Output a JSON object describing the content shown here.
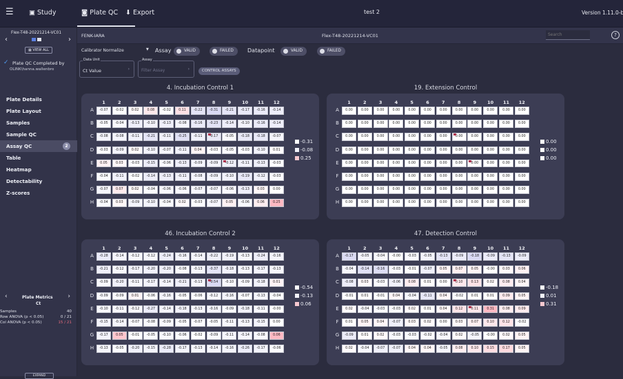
{
  "topbar": {
    "menu_icon": "hamburger-icon",
    "study": "Study",
    "plate_qc": "Plate QC",
    "export": "Export",
    "title": "test 2",
    "version": "Version 1.11.0-beta"
  },
  "sidebar": {
    "plate_name": "Flex-T48-20221214-VC01",
    "view_all": "VIEW ALL",
    "completed": "Plate QC Completed by",
    "user": "OLINK\\hanna.wallenbro",
    "nav": [
      "Plate Details",
      "Plate Layout",
      "Samples",
      "Sample QC",
      "Assay QC",
      "Table",
      "Heatmap",
      "Detectability",
      "Z-scores"
    ],
    "assay_qc_badge": "2",
    "metrics": {
      "title": "Plate Metrics",
      "sub": "Ct",
      "rows": [
        {
          "k": "Samples",
          "v": "40"
        },
        {
          "k": "Row ANOVA (p < 0.05)",
          "v": "0 / 21"
        },
        {
          "k": "Col ANOVA (p < 0.05)",
          "v": "15 / 21"
        }
      ]
    },
    "expand": "EXPAND"
  },
  "header": {
    "left": "FENK-IARA",
    "center": "Flex-T48-20221214-VC01",
    "search_placeholder": "Search",
    "help": "?"
  },
  "filters": {
    "normalize": "Calibrator Normalize",
    "assay": "Assay",
    "valid": "VALID",
    "failed": "FAILED",
    "datapoint": "Datapoint",
    "data_unit_label": "Data Unit",
    "data_unit": "Ct Value",
    "assay_label": "Assay",
    "assay_placeholder": "Filter Assay",
    "control": "CONTROL ASSAYS"
  },
  "rows": [
    "A",
    "B",
    "C",
    "D",
    "E",
    "F",
    "G",
    "H"
  ],
  "cols": [
    "1",
    "2",
    "3",
    "4",
    "5",
    "6",
    "7",
    "8",
    "9",
    "10",
    "11",
    "12"
  ],
  "plots": [
    {
      "title": "4. Incubation Control 1",
      "legend": [
        "-0.31",
        "-0.08",
        "0.25"
      ],
      "colors": [
        "#ffffff",
        "#f1f1f8",
        "#f6c8cf"
      ],
      "flags": [
        "C8",
        "E9"
      ],
      "v": [
        [
          "-0.07",
          "-0.02",
          "0.02",
          "0.08",
          "-0.02",
          "0.11",
          "-0.22",
          "-0.31",
          "-0.21",
          "-0.17",
          "-0.16",
          "-0.14"
        ],
        [
          "-0.05",
          "-0.04",
          "-0.13",
          "-0.10",
          "-0.13",
          "-0.08",
          "-0.16",
          "-0.23",
          "-0.14",
          "-0.10",
          "-0.16",
          "-0.14"
        ],
        [
          "-0.08",
          "-0.08",
          "-0.11",
          "-0.21",
          "-0.11",
          "-0.25",
          "-0.11",
          "-0.17",
          "-0.05",
          "-0.18",
          "-0.18",
          "-0.07"
        ],
        [
          "-0.03",
          "-0.09",
          "0.02",
          "-0.10",
          "-0.07",
          "-0.11",
          "0.04",
          "-0.03",
          "-0.05",
          "-0.03",
          "-0.10",
          "0.01"
        ],
        [
          "0.05",
          "0.03",
          "-0.03",
          "-0.15",
          "-0.06",
          "-0.13",
          "-0.09",
          "-0.09",
          "-0.12",
          "-0.11",
          "-0.13",
          "-0.03"
        ],
        [
          "-0.04",
          "-0.11",
          "-0.02",
          "-0.14",
          "-0.13",
          "-0.11",
          "-0.08",
          "-0.09",
          "-0.10",
          "-0.19",
          "-0.12",
          "-0.03"
        ],
        [
          "-0.07",
          "0.07",
          "0.02",
          "-0.04",
          "-0.06",
          "-0.06",
          "-0.07",
          "-0.07",
          "-0.06",
          "-0.13",
          "0.03",
          "0.00"
        ],
        [
          "-0.04",
          "0.03",
          "-0.09",
          "-0.10",
          "-0.04",
          "0.02",
          "-0.03",
          "-0.07",
          "0.05",
          "-0.06",
          "0.06",
          "0.25"
        ]
      ]
    },
    {
      "title": "19. Extension Control",
      "legend": [
        "0.00",
        "0.00",
        "0.00"
      ],
      "colors": [
        "#ffffff",
        "#ffffff",
        "#ffffff"
      ],
      "flags": [
        "C8",
        "E9"
      ],
      "v": [
        [
          "0.00",
          "0.00",
          "0.00",
          "0.00",
          "0.00",
          "0.00",
          "0.00",
          "0.00",
          "0.00",
          "0.00",
          "0.00",
          "0.00"
        ],
        [
          "0.00",
          "0.00",
          "0.00",
          "0.00",
          "0.00",
          "0.00",
          "0.00",
          "0.00",
          "0.00",
          "0.00",
          "0.00",
          "0.00"
        ],
        [
          "0.00",
          "0.00",
          "0.00",
          "0.00",
          "0.00",
          "0.00",
          "0.00",
          "0.00",
          "0.00",
          "0.00",
          "0.00",
          "0.00"
        ],
        [
          "0.00",
          "0.00",
          "0.00",
          "0.00",
          "0.00",
          "0.00",
          "0.00",
          "0.00",
          "0.00",
          "0.00",
          "0.00",
          "0.00"
        ],
        [
          "0.00",
          "0.00",
          "0.00",
          "0.00",
          "0.00",
          "0.00",
          "0.00",
          "0.00",
          "0.00",
          "0.00",
          "0.00",
          "0.00"
        ],
        [
          "0.00",
          "0.00",
          "0.00",
          "0.00",
          "0.00",
          "0.00",
          "0.00",
          "0.00",
          "0.00",
          "0.00",
          "0.00",
          "0.00"
        ],
        [
          "0.00",
          "0.00",
          "0.00",
          "0.00",
          "0.00",
          "0.00",
          "0.00",
          "0.00",
          "0.00",
          "0.00",
          "0.00",
          "0.00"
        ],
        [
          "0.00",
          "0.00",
          "0.00",
          "0.00",
          "0.00",
          "0.00",
          "0.00",
          "0.00",
          "0.00",
          "0.00",
          "0.00",
          "0.00"
        ]
      ]
    },
    {
      "title": "46. Incubation Control 2",
      "legend": [
        "-0.54",
        "-0.13",
        "0.06"
      ],
      "colors": [
        "#ffffff",
        "#f1f1f8",
        "#f6c8cf"
      ],
      "flags": [
        "C8"
      ],
      "v": [
        [
          "-0.28",
          "-0.14",
          "-0.12",
          "-0.12",
          "-0.24",
          "-0.16",
          "-0.14",
          "-0.22",
          "-0.19",
          "-0.13",
          "-0.24",
          "-0.16"
        ],
        [
          "-0.21",
          "-0.12",
          "-0.17",
          "-0.20",
          "-0.20",
          "-0.08",
          "-0.13",
          "-0.37",
          "-0.18",
          "-0.13",
          "-0.17",
          "-0.13"
        ],
        [
          "-0.09",
          "-0.20",
          "-0.11",
          "-0.17",
          "-0.14",
          "-0.21",
          "-0.13",
          "-0.54",
          "-0.10",
          "-0.09",
          "-0.18",
          "0.01"
        ],
        [
          "-0.09",
          "-0.09",
          "0.01",
          "-0.06",
          "-0.16",
          "-0.05",
          "-0.06",
          "-0.12",
          "-0.16",
          "-0.07",
          "-0.13",
          "-0.04"
        ],
        [
          "-0.10",
          "-0.11",
          "-0.12",
          "-0.27",
          "-0.14",
          "-0.18",
          "-0.13",
          "-0.16",
          "-0.09",
          "-0.18",
          "-0.11",
          "-0.00"
        ],
        [
          "-0.15",
          "-0.14",
          "-0.07",
          "-0.08",
          "-0.09",
          "-0.05",
          "-0.07",
          "-0.05",
          "-0.11",
          "-0.13",
          "-0.15",
          "0.00"
        ],
        [
          "-0.17",
          "0.05",
          "-0.01",
          "-0.05",
          "-0.10",
          "-0.06",
          "-0.02",
          "-0.09",
          "-0.11",
          "-0.14",
          "-0.08",
          "0.06"
        ],
        [
          "-0.13",
          "-0.05",
          "-0.20",
          "-0.15",
          "-0.28",
          "-0.17",
          "-0.13",
          "-0.14",
          "-0.16",
          "-0.26",
          "-0.17",
          "-0.06"
        ]
      ]
    },
    {
      "title": "47. Detection Control",
      "legend": [
        "-0.18",
        "0.01",
        "0.31"
      ],
      "colors": [
        "#ffffff",
        "#f1f1f8",
        "#f6c8cf"
      ],
      "flags": [
        "C8",
        "E9"
      ],
      "v": [
        [
          "-0.17",
          "-0.05",
          "-0.04",
          "-0.00",
          "-0.03",
          "-0.05",
          "-0.13",
          "-0.09",
          "-0.18",
          "-0.09",
          "-0.13",
          "-0.09"
        ],
        [
          "-0.04",
          "-0.14",
          "-0.16",
          "-0.03",
          "-0.01",
          "-0.07",
          "0.05",
          "0.07",
          "0.05",
          "-0.00",
          "0.03",
          "0.06"
        ],
        [
          "-0.08",
          "0.03",
          "-0.03",
          "-0.06",
          "0.08",
          "0.01",
          "0.00",
          "0.10",
          "0.13",
          "0.02",
          "0.08",
          "0.04"
        ],
        [
          "-0.01",
          "0.01",
          "-0.01",
          "0.04",
          "-0.04",
          "-0.11",
          "0.04",
          "-0.02",
          "0.01",
          "0.01",
          "0.09",
          "0.05"
        ],
        [
          "0.02",
          "-0.04",
          "-0.03",
          "-0.03",
          "0.02",
          "0.01",
          "0.04",
          "0.12",
          "0.11",
          "0.31",
          "0.08",
          "0.09"
        ],
        [
          "0.01",
          "0.05",
          "0.04",
          "-0.07",
          "0.03",
          "0.02",
          "0.00",
          "0.03",
          "0.07",
          "0.10",
          "0.12",
          "-0.02"
        ],
        [
          "-0.09",
          "0.01",
          "0.02",
          "-0.03",
          "-0.03",
          "-0.02",
          "-0.04",
          "0.02",
          "-0.05",
          "-0.00",
          "0.02",
          "0.05"
        ],
        [
          "0.02",
          "-0.04",
          "-0.07",
          "-0.07",
          "0.04",
          "0.04",
          "-0.05",
          "0.08",
          "0.10",
          "0.15",
          "0.17",
          "0.05"
        ]
      ]
    }
  ]
}
